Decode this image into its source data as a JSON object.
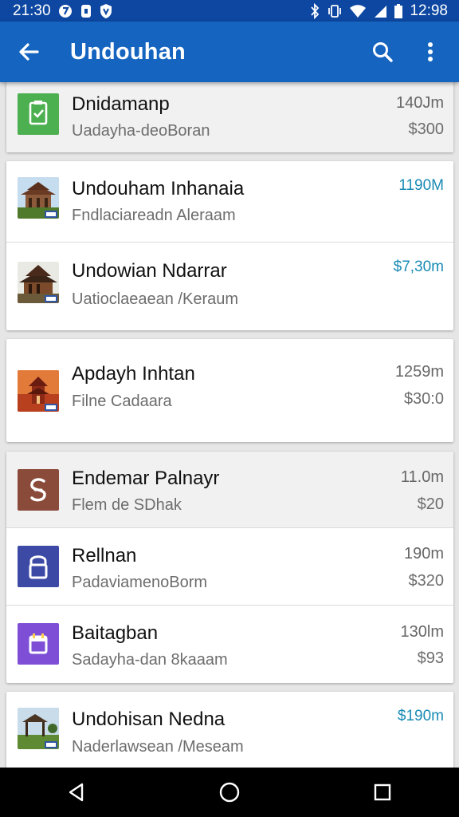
{
  "status_bar": {
    "time_left": "21:30",
    "time_right": "12:98"
  },
  "app_bar": {
    "title": "Undouhan"
  },
  "items": [
    {
      "title": "Dnidamanp",
      "subtitle": "Uadayha-deoBoran",
      "distance": "140Jm",
      "price": "$300",
      "icon": "calendar-check-icon",
      "color": "#4caf50"
    },
    {
      "title": "Undouham Inhanaia",
      "subtitle": "Fndlaciareadn Aleraam",
      "distance": "1190M",
      "price": "",
      "icon": "temple-thumbnail",
      "color": "#1a8bb5"
    },
    {
      "title": "Undowian Ndarrar",
      "subtitle": "Uatioclaeaean /Keraum",
      "distance": "$7,30m",
      "price": "",
      "icon": "temple-thumbnail",
      "color": "#1a8bb5"
    },
    {
      "title": "Apdayh Inhtan",
      "subtitle": "Filne Cadaara",
      "distance": "1259m",
      "price": "$30:0",
      "icon": "pagoda-thumbnail",
      "color": "#d2552c"
    },
    {
      "title": "Endemar Palnayr",
      "subtitle": "Flem de SDhak",
      "distance": "11.0m",
      "price": "$20",
      "icon": "swirl-icon",
      "color": "#8a4b3a"
    },
    {
      "title": "Rellnan",
      "subtitle": "PadaviamenoBorm",
      "distance": "190m",
      "price": "$320",
      "icon": "lock-icon",
      "color": "#3c4aa6"
    },
    {
      "title": "Baitagban",
      "subtitle": "Sadayha-dan 8kaaam",
      "distance": "130lm",
      "price": "$93",
      "icon": "calendar-icon",
      "color": "#7e4fd6"
    },
    {
      "title": "Undohisan Nedna",
      "subtitle": "Naderlawsean /Meseam",
      "distance": "$190m",
      "price": "",
      "icon": "pavilion-thumbnail",
      "color": "#5a8fb0"
    }
  ]
}
